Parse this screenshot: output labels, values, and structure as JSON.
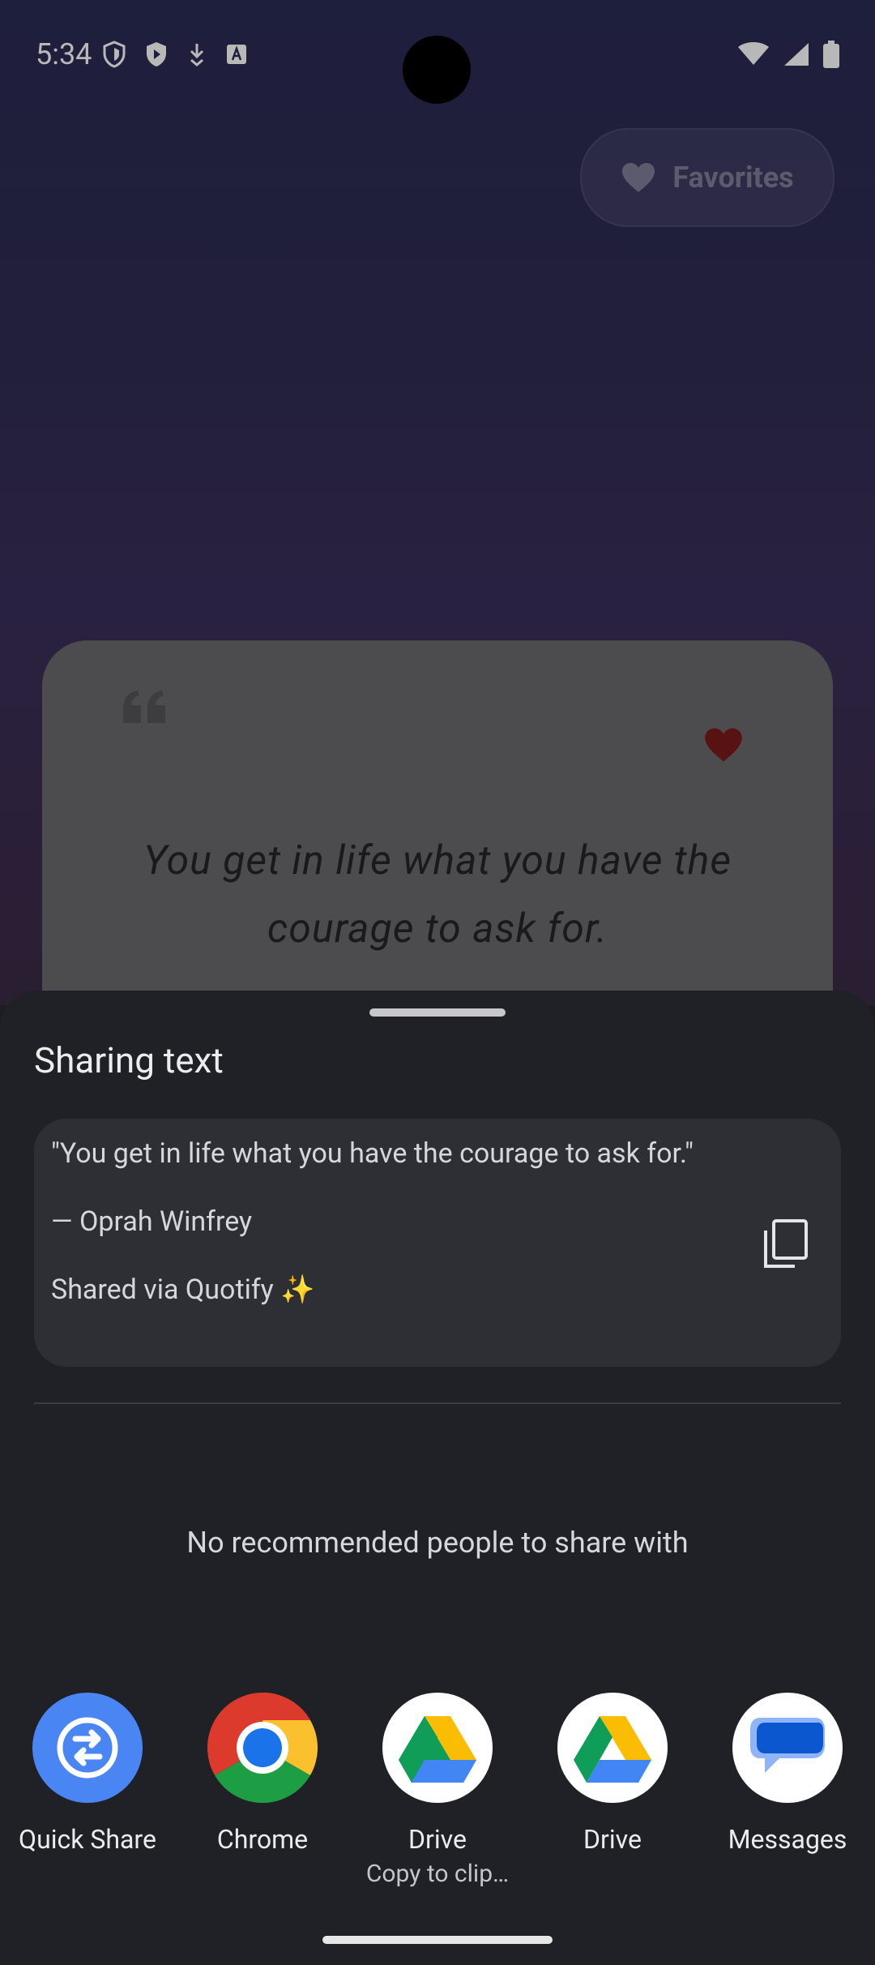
{
  "status_bar": {
    "time": "5:34"
  },
  "header": {
    "favorites_label": "Favorites"
  },
  "quote_card": {
    "quote": "You get in life what you have the courage to ask for.",
    "favorited": true,
    "heart_color": "#7a1a1a"
  },
  "share_sheet": {
    "title": "Sharing text",
    "preview_text": "\"You get in life what you have the courage to ask for.\"\n\n— Oprah Winfrey\n\nShared via Quotify ✨",
    "no_people_text": "No recommended people to share with",
    "targets": [
      {
        "label": "Quick Share",
        "icon": "quick-share-icon",
        "color": "#4a85f4"
      },
      {
        "label": "Chrome",
        "icon": "chrome-icon"
      },
      {
        "label": "Drive",
        "sublabel": "Copy to clip…",
        "icon": "drive-icon"
      },
      {
        "label": "Drive",
        "icon": "drive-icon"
      },
      {
        "label": "Messages",
        "icon": "messages-icon",
        "color": "#0b57d0"
      }
    ]
  }
}
